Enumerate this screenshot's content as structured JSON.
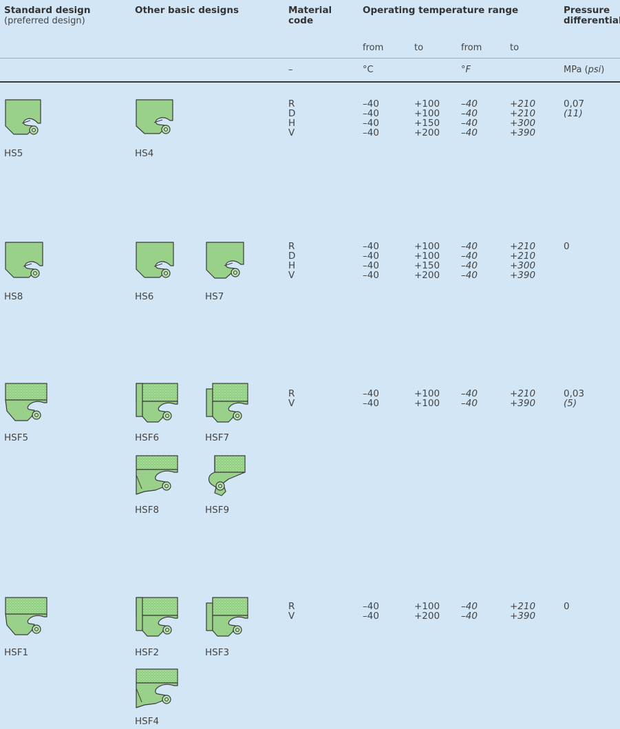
{
  "header": {
    "col_standard": "Standard design",
    "col_standard_sub": "(preferred design)",
    "col_other": "Other basic designs",
    "col_material_1": "Material",
    "col_material_2": "code",
    "col_temp": "Operating temperature range",
    "col_pressure_1": "Pressure",
    "col_pressure_2": "differential",
    "from_c": "from",
    "to_c": "to",
    "from_f": "from",
    "to_f": "to",
    "unit_material": "–",
    "unit_c": "°C",
    "unit_f": "°F",
    "unit_pressure_mpa": "MPa (",
    "unit_pressure_psi": "psi",
    "unit_pressure_close": ")"
  },
  "rows": [
    {
      "standard": "HS5",
      "others": [
        "HS4"
      ],
      "materials": [
        "R",
        "D",
        "H",
        "V"
      ],
      "from_c": [
        "–40",
        "–40",
        "–40",
        "–40"
      ],
      "to_c": [
        "+100",
        "+100",
        "+150",
        "+200"
      ],
      "from_f": [
        "–40",
        "–40",
        "–40",
        "–40"
      ],
      "to_f": [
        "+210",
        "+210",
        "+300",
        "+390"
      ],
      "pressure": "0,07",
      "pressure_psi": "(11)"
    },
    {
      "standard": "HS8",
      "others": [
        "HS6",
        "HS7"
      ],
      "materials": [
        "R",
        "D",
        "H",
        "V"
      ],
      "from_c": [
        "–40",
        "–40",
        "–40",
        "–40"
      ],
      "to_c": [
        "+100",
        "+100",
        "+150",
        "+200"
      ],
      "from_f": [
        "–40",
        "–40",
        "–40",
        "–40"
      ],
      "to_f": [
        "+210",
        "+210",
        "+300",
        "+390"
      ],
      "pressure": "0",
      "pressure_psi": ""
    },
    {
      "standard": "HSF5",
      "others": [
        "HSF6",
        "HSF7",
        "HSF8",
        "HSF9"
      ],
      "materials": [
        "R",
        "V"
      ],
      "from_c": [
        "–40",
        "–40"
      ],
      "to_c": [
        "+100",
        "+100"
      ],
      "from_f": [
        "–40",
        "–40"
      ],
      "to_f": [
        "+210",
        "+390"
      ],
      "pressure": "0,03",
      "pressure_psi": "(5)"
    },
    {
      "standard": "HSF1",
      "others": [
        "HSF2",
        "HSF3",
        "HSF4"
      ],
      "materials": [
        "R",
        "V"
      ],
      "from_c": [
        "–40",
        "–40"
      ],
      "to_c": [
        "+100",
        "+200"
      ],
      "from_f": [
        "–40",
        "–40"
      ],
      "to_f": [
        "+210",
        "+390"
      ],
      "pressure": "0",
      "pressure_psi": ""
    }
  ]
}
